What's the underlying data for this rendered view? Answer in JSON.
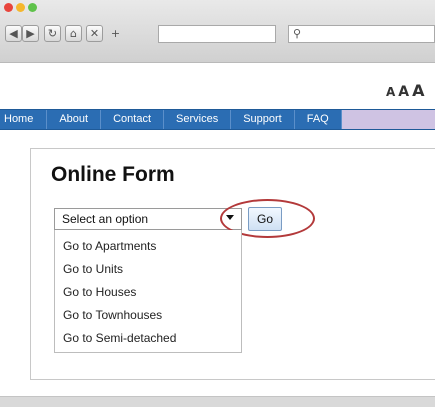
{
  "browser": {
    "traffic_colors": [
      "#e8453c",
      "#f5b72d",
      "#5fc24a"
    ],
    "icons": {
      "back": "◀",
      "forward": "▶",
      "reload": "↻",
      "home": "⌂",
      "stop": "✕",
      "new_tab": "+",
      "search": "⚲"
    }
  },
  "text_size": [
    "A",
    "A",
    "A"
  ],
  "nav": {
    "items": [
      "Home",
      "About",
      "Contact",
      "Services",
      "Support",
      "FAQ"
    ]
  },
  "form": {
    "title": "Online Form",
    "select_value": "Select an option",
    "go_label": "Go",
    "options": [
      "Go to Apartments",
      "Go to Units",
      "Go to Houses",
      "Go to Townhouses",
      "Go to Semi-detached"
    ]
  },
  "colors": {
    "nav_bg": "#2b6db3",
    "highlight_circle": "#b3393a"
  }
}
